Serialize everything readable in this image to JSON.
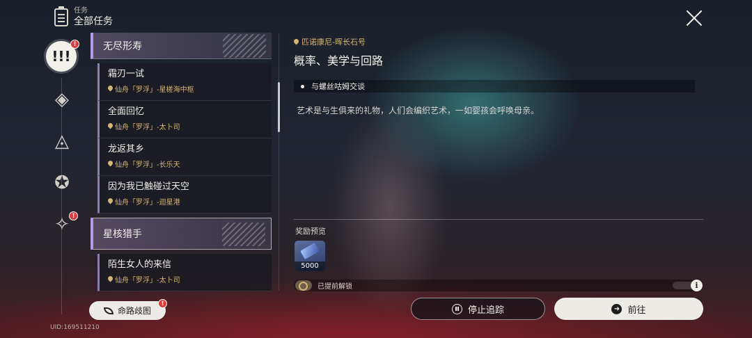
{
  "header": {
    "sub_label": "任务",
    "title": "全部任务"
  },
  "categories": [
    {
      "name": "all-quests",
      "glyph": "!!!",
      "badge": "!"
    },
    {
      "name": "trailblaze",
      "glyph": "◈",
      "badge": ""
    },
    {
      "name": "companion",
      "glyph": "◬",
      "badge": ""
    },
    {
      "name": "adventure",
      "glyph": "✪",
      "badge": ""
    },
    {
      "name": "daily",
      "glyph": "✧",
      "badge": "!"
    }
  ],
  "quest_list": {
    "groups": [
      {
        "title": "无尽形寿",
        "quests": [
          {
            "title": "霜刃一试",
            "location": "仙舟「罗浮」-星槎海中枢"
          },
          {
            "title": "全面回忆",
            "location": "仙舟「罗浮」-太卜司"
          },
          {
            "title": "龙返其乡",
            "location": "仙舟「罗浮」-长乐天"
          },
          {
            "title": "因为我已触碰过天空",
            "location": "仙舟「罗浮」-迴星港"
          }
        ]
      },
      {
        "title": "星核猎手",
        "quests": [
          {
            "title": "陌生女人的来信",
            "location": "仙舟「罗浮」-太卜司"
          }
        ]
      }
    ]
  },
  "detail": {
    "region": "匹诺康尼-晖长石号",
    "title": "概率、美学与回路",
    "objective": "与螺丝咕姆交谈",
    "description": "艺术是与生俱来的礼物，人们会编织艺术，一如婴孩会呼唤母亲。",
    "reward_label": "奖励预览",
    "reward_qty": "5000",
    "unlock_text": "已提前解锁"
  },
  "buttons": {
    "stop": "停止追踪",
    "go": "前往",
    "fate": "命路歧图",
    "info": "i"
  },
  "footer": {
    "uid": "UID:169511210"
  },
  "colors": {
    "accent": "#b79be8",
    "location": "#d6b475",
    "badge": "#d93a3a"
  }
}
